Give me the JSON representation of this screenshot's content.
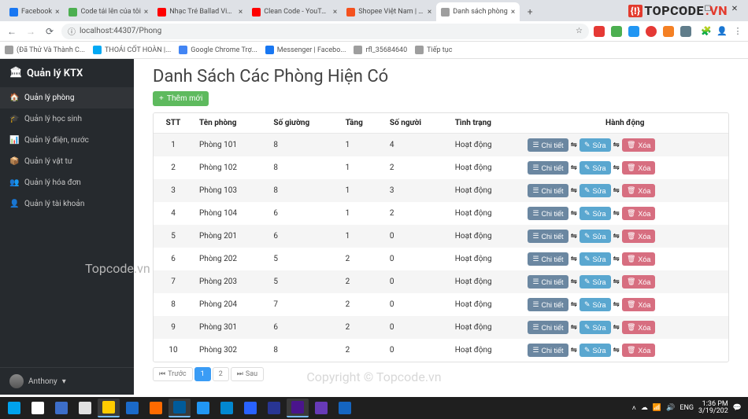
{
  "browser": {
    "tabs": [
      {
        "label": "Facebook",
        "favColor": "#1877f2"
      },
      {
        "label": "Code tải lên của tôi",
        "favColor": "#4caf50"
      },
      {
        "label": "Nhạc Trẻ Ballad Việt Hay N",
        "favColor": "#ff0000"
      },
      {
        "label": "Clean Code - YouTube",
        "favColor": "#ff0000"
      },
      {
        "label": "Shopee Việt Nam | Mua và Bá",
        "favColor": "#f4511e"
      },
      {
        "label": "Danh sách phòng",
        "favColor": "#9e9e9e",
        "active": true
      }
    ],
    "url": "localhost:44307/Phong",
    "bookmarks": [
      {
        "label": "(Đã Thử Và Thành C...",
        "color": "#9e9e9e"
      },
      {
        "label": "THOÁI CỐT HOÀN |...",
        "color": "#03a9f4"
      },
      {
        "label": "Google Chrome Trợ...",
        "color": "#4285f4"
      },
      {
        "label": "Messenger | Facebo...",
        "color": "#1877f2"
      },
      {
        "label": "rfl_35684640",
        "color": "#9e9e9e"
      },
      {
        "label": "Tiếp tục",
        "color": "#9e9e9e"
      }
    ]
  },
  "watermarks": {
    "logo_prefix": "TOPCODE",
    "logo_suffix": ".VN",
    "left": "Topcode.vn",
    "center": "Copyright © Topcode.vn"
  },
  "sidebar": {
    "brand": "Quản lý KTX",
    "items": [
      {
        "icon": "🏠",
        "label": "Quản lý phòng",
        "active": true
      },
      {
        "icon": "🎓",
        "label": "Quản lý học sinh"
      },
      {
        "icon": "📊",
        "label": "Quản lý điện, nước"
      },
      {
        "icon": "📦",
        "label": "Quản lý vật tư"
      },
      {
        "icon": "👥",
        "label": "Quản lý hóa đơn"
      },
      {
        "icon": "👤",
        "label": "Quản lý tài khoản"
      }
    ],
    "user": "Anthony"
  },
  "page": {
    "title": "Danh Sách Các Phòng Hiện Có",
    "add_label": "Thêm mới",
    "columns": {
      "stt": "STT",
      "ten": "Tên phòng",
      "giuong": "Số giường",
      "tang": "Tầng",
      "nguoi": "Số người",
      "tinhtrang": "Tình trạng",
      "hanhdong": "Hành động"
    },
    "actions": {
      "detail": "Chi tiết",
      "edit": "Sửa",
      "del": "Xóa"
    },
    "rows": [
      {
        "stt": 1,
        "ten": "Phòng 101",
        "giuong": 8,
        "tang": 1,
        "nguoi": 4,
        "tt": "Hoạt động"
      },
      {
        "stt": 2,
        "ten": "Phòng 102",
        "giuong": 8,
        "tang": 1,
        "nguoi": 2,
        "tt": "Hoạt động"
      },
      {
        "stt": 3,
        "ten": "Phòng 103",
        "giuong": 8,
        "tang": 1,
        "nguoi": 3,
        "tt": "Hoạt động"
      },
      {
        "stt": 4,
        "ten": "Phòng 104",
        "giuong": 6,
        "tang": 1,
        "nguoi": 2,
        "tt": "Hoạt động"
      },
      {
        "stt": 5,
        "ten": "Phòng 201",
        "giuong": 6,
        "tang": 1,
        "nguoi": 0,
        "tt": "Hoạt động"
      },
      {
        "stt": 6,
        "ten": "Phòng 202",
        "giuong": 5,
        "tang": 2,
        "nguoi": 0,
        "tt": "Hoạt động"
      },
      {
        "stt": 7,
        "ten": "Phòng 203",
        "giuong": 5,
        "tang": 2,
        "nguoi": 0,
        "tt": "Hoạt động"
      },
      {
        "stt": 8,
        "ten": "Phòng 204",
        "giuong": 7,
        "tang": 2,
        "nguoi": 0,
        "tt": "Hoạt động"
      },
      {
        "stt": 9,
        "ten": "Phòng 301",
        "giuong": 6,
        "tang": 2,
        "nguoi": 0,
        "tt": "Hoạt động"
      },
      {
        "stt": 10,
        "ten": "Phòng 302",
        "giuong": 8,
        "tang": 2,
        "nguoi": 0,
        "tt": "Hoạt động"
      }
    ],
    "pager": {
      "prev": "Trước",
      "next": "Sau",
      "pages": [
        "1",
        "2"
      ],
      "active": "1"
    }
  },
  "taskbar": {
    "items": [
      {
        "color": "#00a2ed",
        "name": "start"
      },
      {
        "color": "#ffffff",
        "name": "search"
      },
      {
        "color": "#3d6ec9",
        "name": "task-view"
      },
      {
        "color": "#e0e0e0",
        "name": "explorer"
      },
      {
        "color": "#ffcc00",
        "name": "chrome",
        "active": true
      },
      {
        "color": "#1b6ac9",
        "name": "edge"
      },
      {
        "color": "#ff6a00",
        "name": "ai"
      },
      {
        "color": "#005b9a",
        "name": "vscode",
        "active": true
      },
      {
        "color": "#2196f3",
        "name": "app1"
      },
      {
        "color": "#0288d1",
        "name": "app2"
      },
      {
        "color": "#2962ff",
        "name": "messenger"
      },
      {
        "color": "#283593",
        "name": "ps"
      },
      {
        "color": "#4a148c",
        "name": "vs",
        "active": true
      },
      {
        "color": "#673ab7",
        "name": "onenote"
      },
      {
        "color": "#1565c0",
        "name": "word"
      }
    ],
    "time": "1:36 PM",
    "date": "3/19/202"
  }
}
